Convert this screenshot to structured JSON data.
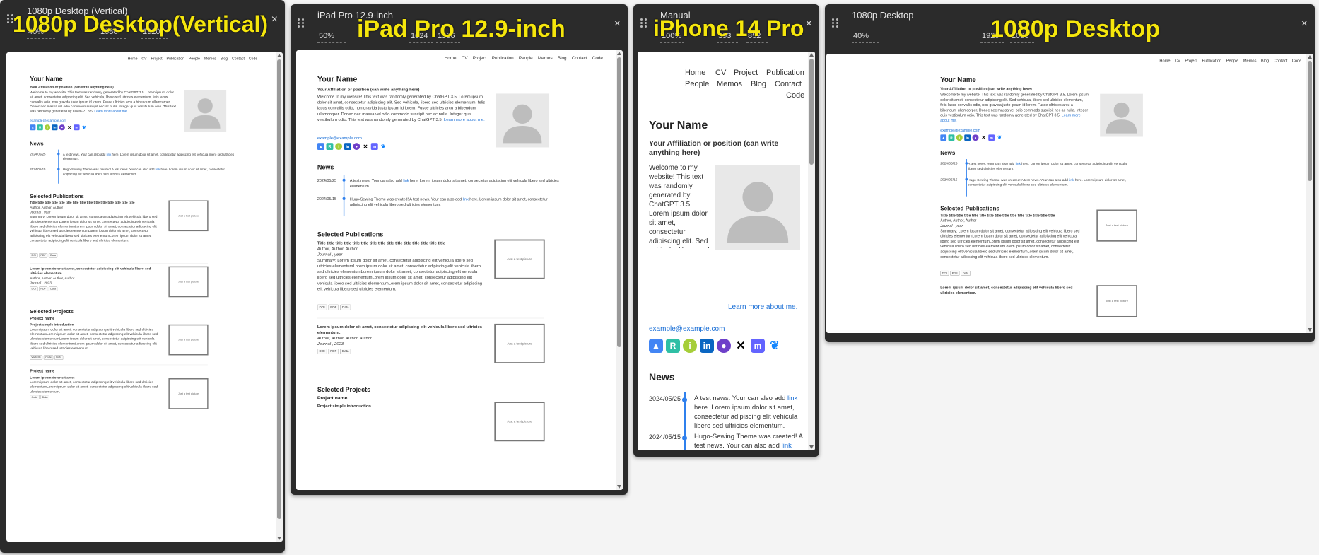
{
  "nav": {
    "home": "Home",
    "cv": "CV",
    "project": "Project",
    "publication": "Publication",
    "people": "People",
    "memos": "Memos",
    "blog": "Blog",
    "contact": "Contact",
    "code": "Code"
  },
  "content": {
    "name": "Your Name",
    "affiliation": "Your Affiliation or position (can write anything here)",
    "bio": "Welcome to my website! This text was randomly generated by ChatGPT 3.5. Lorem ipsum dolor sit amet, consectetur adipiscing elit. Sed vehicula, libero sed ultricies elementum, felis lacus convallis odio, non gravida justo ipsum id lorem. Fusce ultricies arcu a bibendum ullamcorper. Donec nec massa vel odio commodo suscipit nec ac nulla. Integer quis vestibulum odio. This text was randomly generated by ChatGPT 3.5.",
    "bio_link": "Learn more about me.",
    "email": "example@example.com",
    "news_title": "News",
    "news": [
      {
        "date": "2024/05/25",
        "text": "A test news. Your can also add",
        "link": "link",
        "rest": "here. Lorem ipsum dolor sit amet, consectetur adipiscing elit vehicula libero sed ultricies elementum."
      },
      {
        "date": "2024/05/15",
        "text": "Hugo-Sewing Theme was created! A test news. Your can also add",
        "link": "link",
        "rest": "here. Lorem ipsum dolor sit amet, consectetur adipiscing elit vehicula libero sed ultricies elementum."
      }
    ],
    "pubs_title": "Selected Publications",
    "pub1_title": "Title title title title title title title title title title title title title title title",
    "pub1_authors": "Author, Author, Author",
    "pub1_journal": "Journal , year",
    "pub1_summary": "Summary: Lorem ipsum dolor sit amet, consectetur adipiscing elit vehicula libero sed ultricies elementumLorem ipsum dolor sit amet, consectetur adipiscing elit vehicula libero sed ultricies elementumLorem ipsum dolor sit amet, consectetur adipiscing elit vehicula libero sed ultricies elementumLorem ipsum dolor sit amet, consectetur adipiscing elit vehicula libero sed ultricies elementumLorem ipsum dolor sit amet, consectetur adipiscing elit vehicula libero sed ultricies elementum.",
    "pub2_title": "Lorem ipsum dolor sit amet, consectetur adipiscing elit vehicula libero sed ultricies elementum.",
    "pub2_authors": "Author, Author, Author, Author",
    "pub2_journal": "Journal , 2023",
    "btn_doi": "DOI",
    "btn_pdf": "PDF",
    "btn_data": "Data",
    "btn_website": "Website",
    "btn_code": "Code",
    "thumb": "Just a test picture",
    "projects_title": "Selected Projects",
    "proj1_name": "Project name",
    "proj1_intro": "Project simple introduction",
    "proj1_text": "Lorem ipsum dolor sit amet, consectetur adipiscing elit vehicula libero sed ultricies elementumLorem ipsum dolor sit amet, consectetur adipiscing elit vehicula libero sed ultricies elementumLorem ipsum dolor sit amet, consectetur adipiscing elit vehicula libero sed ultricies elementumLorem ipsum dolor sit amet, consectetur adipiscing elit vehicula libero sed ultricies elementum.",
    "proj2_name": "Project name",
    "proj2_intro": "Lorem ipsum dolor sit amet",
    "proj2_text": "Lorem ipsum dolor sit amet, consectetur adipiscing elit vehicula libero sed ultricies elementumLorem ipsum dolor sit amet, consectetur adipiscing elit vehicula libero sed ultricies elementum."
  },
  "frames": [
    {
      "title": "1080p Desktop (Vertical)",
      "zoom": "40%",
      "width": "1080",
      "height": "1920",
      "overlay": "1080p Desktop(Vertical)"
    },
    {
      "title": "iPad Pro 12.9-inch",
      "zoom": "50%",
      "width": "1024",
      "height": "1366",
      "overlay": "iPad Pro 12.9-inch"
    },
    {
      "title": "Manual",
      "zoom": "100%",
      "width": "393",
      "height": "852",
      "overlay": "iPhone 14 Pro"
    },
    {
      "title": "1080p Desktop",
      "zoom": "40%",
      "width": "1920",
      "height": "1080",
      "overlay": "1080p Desktop"
    }
  ],
  "icon_names": [
    "google-scholar-icon",
    "researchgate-icon",
    "orcid-icon",
    "linkedin-icon",
    "github-icon",
    "x-icon",
    "mastodon-icon",
    "bluesky-icon"
  ],
  "colors": {
    "accent": "#2f80ed",
    "overlay": "#f5e60c",
    "frame": "#2b2b2b"
  }
}
